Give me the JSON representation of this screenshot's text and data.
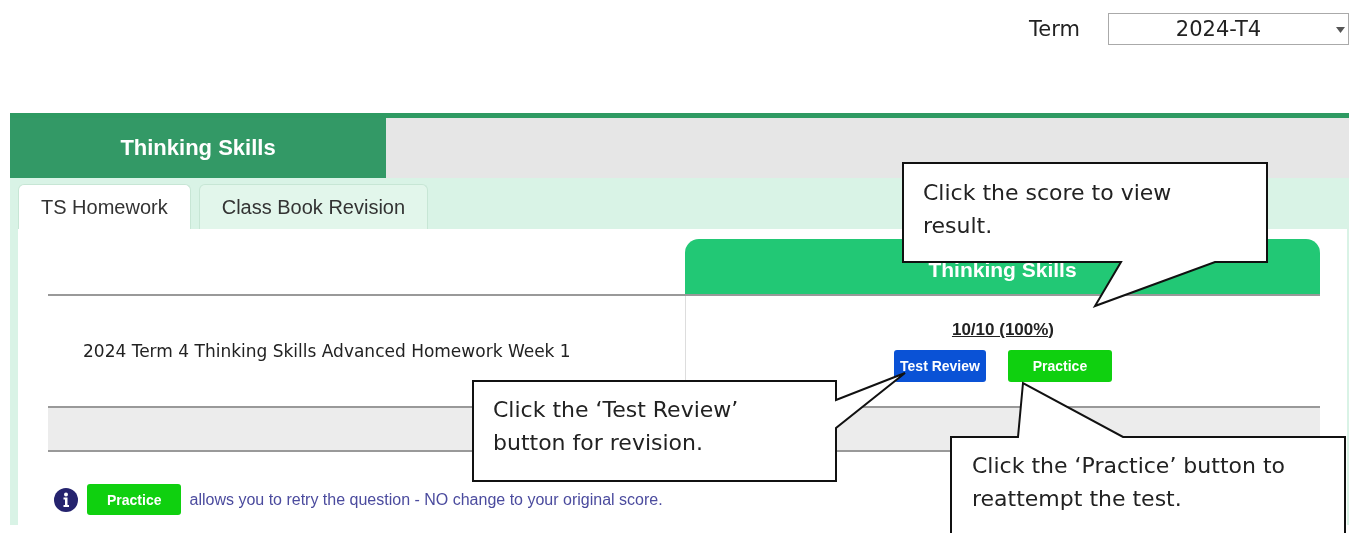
{
  "term": {
    "label": "Term",
    "value": "2024-T4"
  },
  "subject_tabs": [
    {
      "label": "Thinking Skills",
      "selected": true
    }
  ],
  "subtabs": [
    {
      "label": "TS Homework",
      "selected": true
    },
    {
      "label": "Class Book Revision",
      "selected": false
    }
  ],
  "table": {
    "score_column": "Thinking Skills",
    "rows": [
      {
        "name": "2024 Term 4 Thinking Skills Advanced Homework Week 1",
        "score": "10/10 (100%)",
        "buttons": [
          {
            "label": "Test Review",
            "kind": "review"
          },
          {
            "label": "Practice",
            "kind": "practice"
          }
        ]
      }
    ]
  },
  "note": {
    "badge": "Practice",
    "text": "allows you to retry the question - NO change to your original score."
  },
  "callouts": [
    {
      "text": "Click the score to view result."
    },
    {
      "text": "Click the ‘Test Review’ button for revision."
    },
    {
      "text": "Click the ‘Practice’ button to reattempt the test."
    }
  ]
}
